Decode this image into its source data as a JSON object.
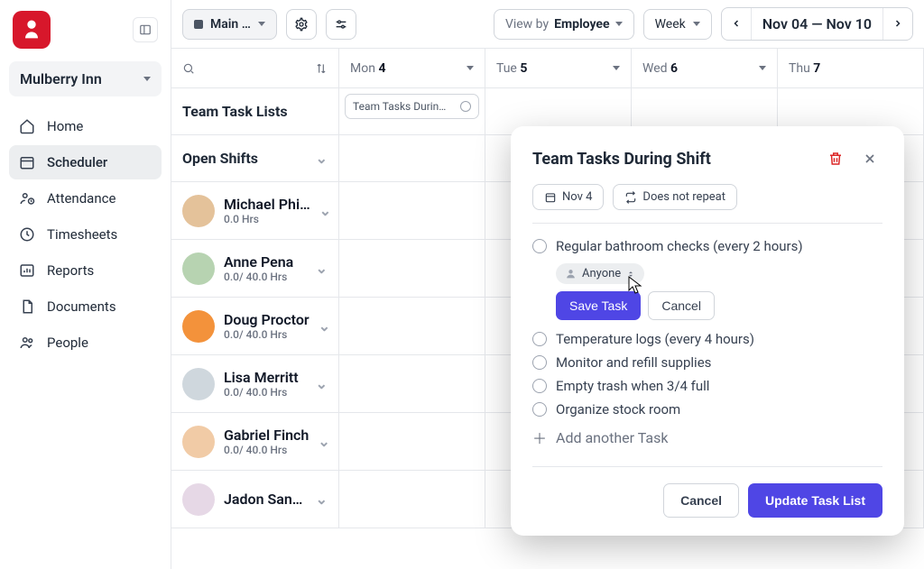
{
  "org": {
    "name": "Mulberry Inn"
  },
  "nav": {
    "items": [
      {
        "label": "Home",
        "icon": "home-icon"
      },
      {
        "label": "Scheduler",
        "icon": "calendar-icon",
        "active": true
      },
      {
        "label": "Attendance",
        "icon": "clock-person-icon"
      },
      {
        "label": "Timesheets",
        "icon": "clock-icon"
      },
      {
        "label": "Reports",
        "icon": "chart-icon"
      },
      {
        "label": "Documents",
        "icon": "document-icon"
      },
      {
        "label": "People",
        "icon": "people-icon"
      }
    ]
  },
  "topbar": {
    "location_label": "Main …",
    "viewby_label": "View by",
    "viewby_value": "Employee",
    "range_label": "Week",
    "range_text": "Nov 04 — Nov 10"
  },
  "days": [
    {
      "label": "Mon",
      "num": "4"
    },
    {
      "label": "Tue",
      "num": "5"
    },
    {
      "label": "Wed",
      "num": "6"
    },
    {
      "label": "Thu",
      "num": "7"
    }
  ],
  "rows": {
    "teamTasksLabel": "Team Task Lists",
    "openShiftsLabel": "Open Shifts",
    "employees": [
      {
        "name": "Michael Phi…",
        "hrs": "0.0 Hrs",
        "color": "#e4c29a"
      },
      {
        "name": "Anne Pena",
        "hrs": "0.0/ 40.0 Hrs",
        "color": "#b7d3b1"
      },
      {
        "name": "Doug Proctor",
        "hrs": "0.0/ 40.0 Hrs",
        "color": "#f3923b"
      },
      {
        "name": "Lisa Merritt",
        "hrs": "0.0/ 40.0 Hrs",
        "color": "#cfd7dd"
      },
      {
        "name": "Gabriel Finch",
        "hrs": "0.0/ 40.0 Hrs",
        "color": "#f1cba6"
      },
      {
        "name": "Jadon San…",
        "hrs": "",
        "color": "#e6d8e6"
      }
    ],
    "taskChip": "Team Tasks Durin…"
  },
  "popover": {
    "title": "Team Tasks During Shift",
    "date_chip": "Nov 4",
    "repeat_chip": "Does not repeat",
    "active_task": "Regular bathroom checks (every 2 hours)",
    "assignee": "Anyone",
    "save_label": "Save Task",
    "cancel_small": "Cancel",
    "tasks": [
      "Temperature logs (every 4 hours)",
      "Monitor and refill supplies",
      "Empty trash when 3/4 full",
      "Organize stock room"
    ],
    "add_label": "Add another Task",
    "cancel_big": "Cancel",
    "update_label": "Update Task List"
  }
}
